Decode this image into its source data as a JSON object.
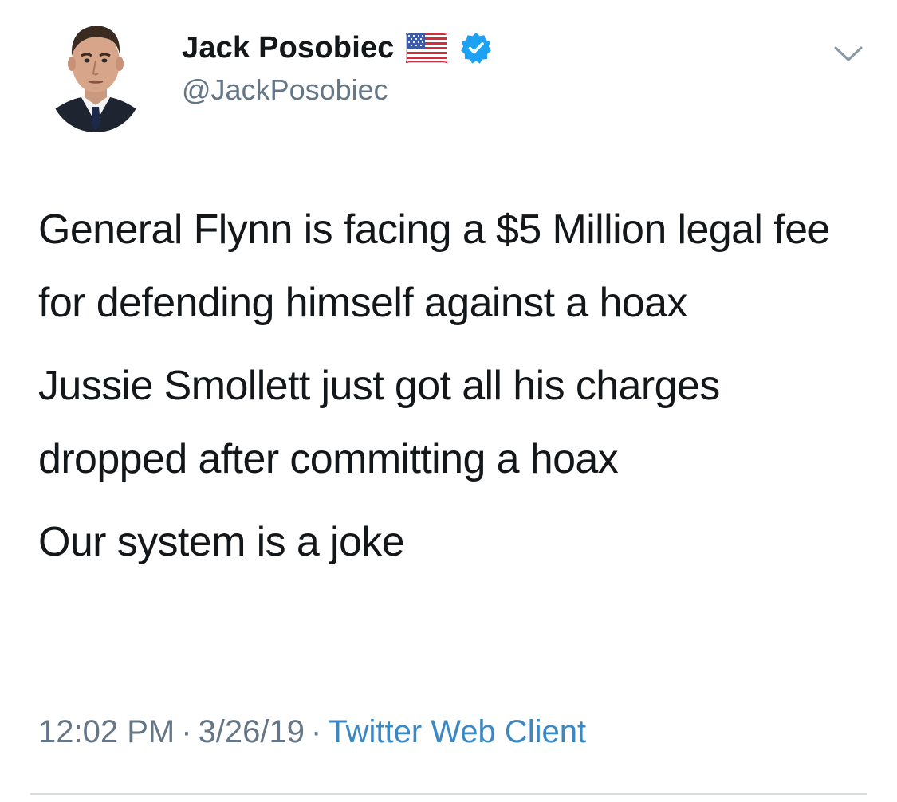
{
  "user": {
    "display_name": "Jack Posobiec",
    "handle": "@JackPosobiec",
    "name_flag_icon": "us-flag-icon",
    "verified_icon": "verified-badge-icon"
  },
  "menu": {
    "icon": "chevron-down-icon"
  },
  "tweet": {
    "paragraphs": [
      "General Flynn is facing a $5 Million legal fee for defending himself against a hoax",
      "Jussie Smollett just got all his charges dropped after committing a hoax",
      "Our system is a joke"
    ],
    "time": "12:02 PM",
    "separator": "·",
    "date": "3/26/19",
    "client": "Twitter Web Client"
  },
  "colors": {
    "text_primary": "#14171a",
    "text_secondary": "#657786",
    "link": "#3b88c3",
    "verified": "#1da1f2",
    "divider": "#d8dde1"
  }
}
